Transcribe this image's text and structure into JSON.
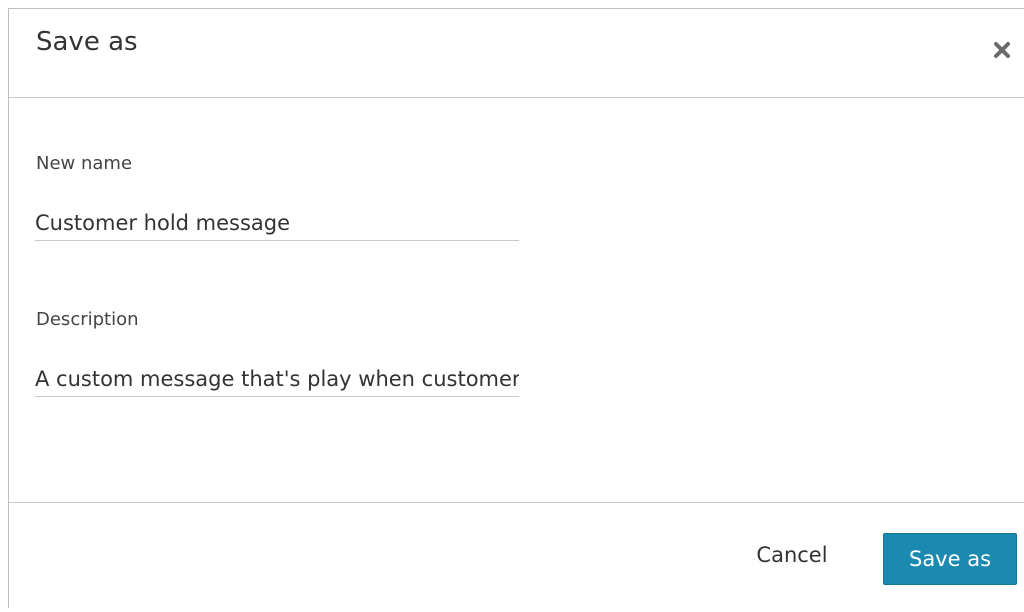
{
  "dialog": {
    "title": "Save as",
    "close_icon": "close-icon"
  },
  "form": {
    "name_label": "New name",
    "name_value": "Customer hold message",
    "description_label": "Description",
    "description_value": "A custom message that's play when customer is on hold"
  },
  "footer": {
    "cancel_label": "Cancel",
    "save_label": "Save as"
  },
  "colors": {
    "primary_button": "#1a8ab0",
    "divider": "#c9c9c9",
    "text": "#333333"
  }
}
